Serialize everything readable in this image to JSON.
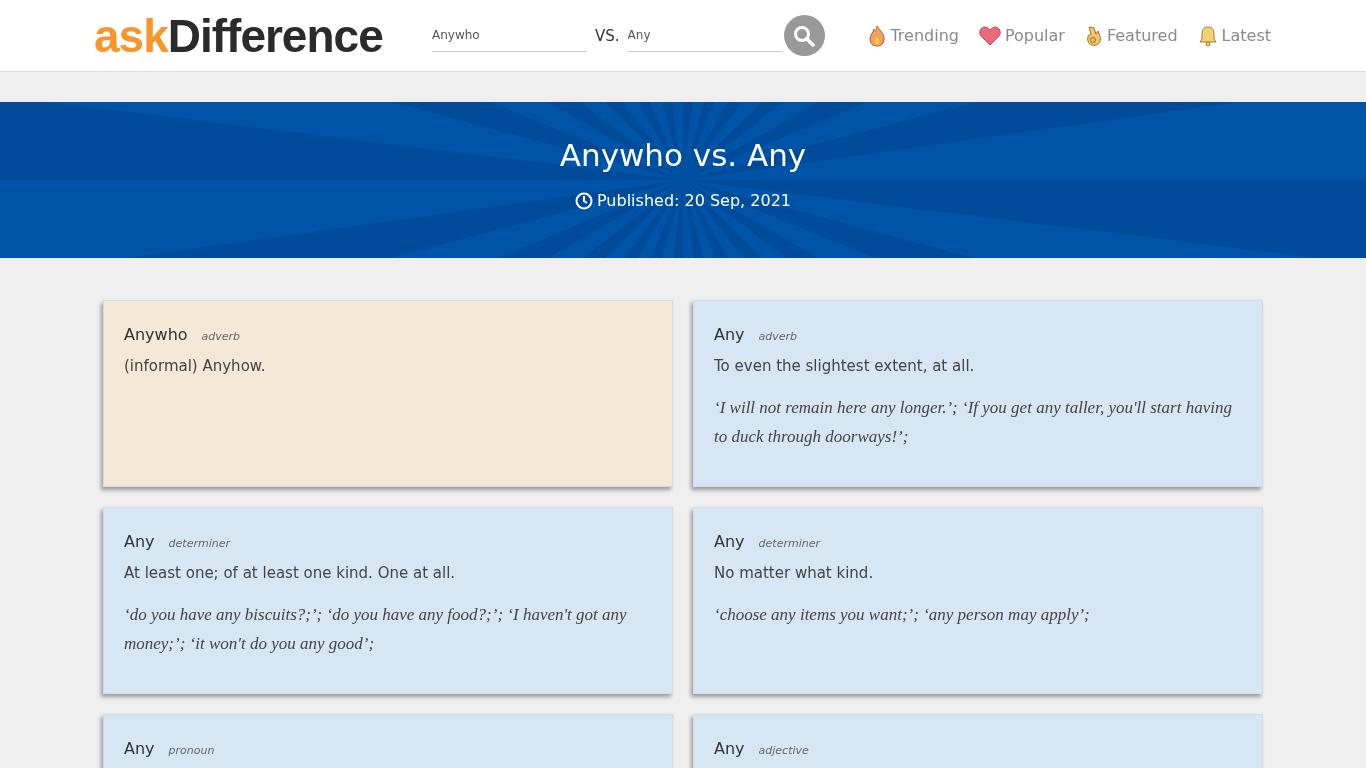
{
  "header": {
    "logo": {
      "prefix": "ask",
      "name": "Difference"
    },
    "search": {
      "first": "Anywho",
      "separator": "VS.",
      "second": "Any"
    },
    "nav": [
      {
        "label": "Trending",
        "kind": "fire"
      },
      {
        "label": "Popular",
        "kind": "heart"
      },
      {
        "label": "Featured",
        "kind": "hand"
      },
      {
        "label": "Latest",
        "kind": "bell"
      }
    ]
  },
  "banner": {
    "title": "Anywho vs. Any",
    "published": "Published: 20 Sep, 2021"
  },
  "cards": [
    {
      "word": "Anywho",
      "pos": "adverb",
      "definition": "(informal) Anyhow.",
      "color": "#f4e8d6"
    },
    {
      "word": "Any",
      "pos": "adverb",
      "definition": "To even the slightest extent, at all.",
      "example": "‘I will not remain here any longer.’; ‘If you get any taller, you'll start having to duck through doorways!’;",
      "color": "#d6e6f4"
    },
    {
      "word": "Any",
      "pos": "determiner",
      "definition": "At least one; of at least one kind. One at all.",
      "example": "‘do you have any biscuits?;’; ‘do you have any food?;’; ‘I haven't got any money;’; ‘it won't do you any good’;",
      "color": "#d6e6f4"
    },
    {
      "word": "Any",
      "pos": "determiner",
      "definition": "No matter what kind.",
      "example": "‘choose any items you want;’; ‘any person may apply’;",
      "color": "#d6e6f4"
    },
    {
      "word": "Any",
      "pos": "pronoun",
      "color": "#d6e6f4"
    },
    {
      "word": "Any",
      "pos": "adjective",
      "color": "#d6e6f4"
    }
  ]
}
